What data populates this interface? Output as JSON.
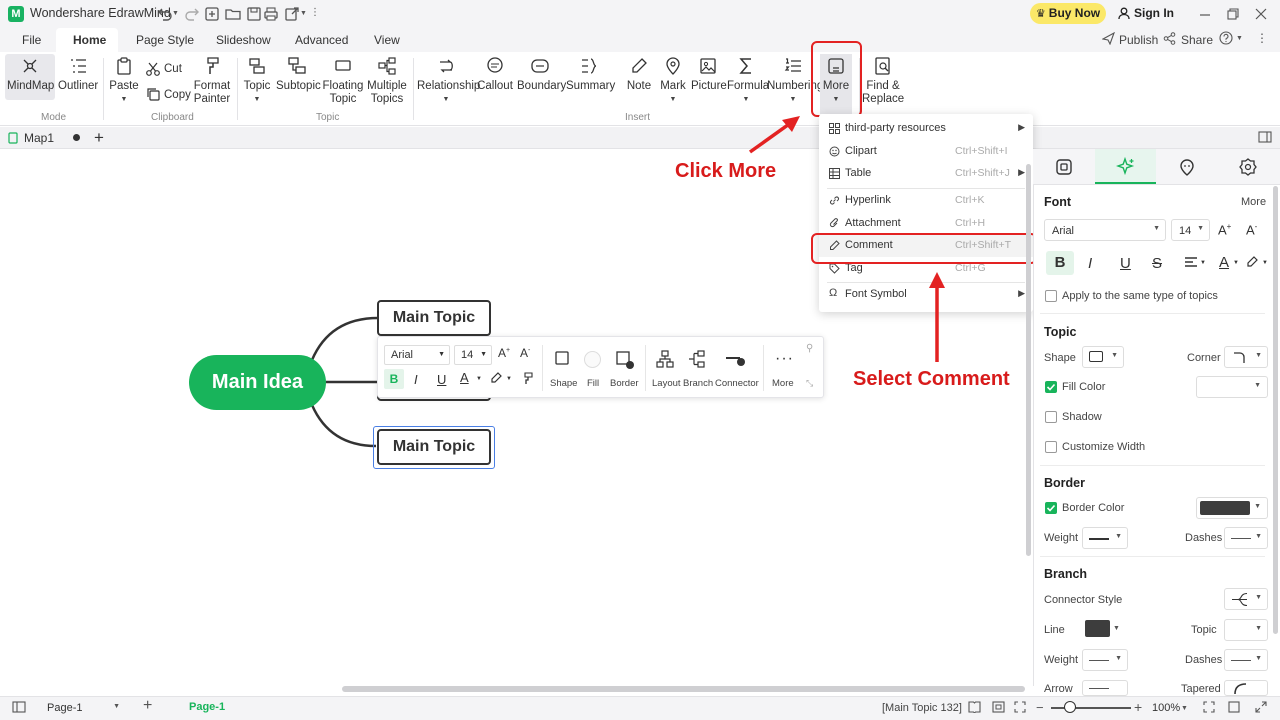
{
  "titlebar": {
    "app_title": "Wondershare EdrawMind",
    "buy_now": "Buy Now",
    "sign_in": "Sign In"
  },
  "menu": {
    "tabs": [
      "File",
      "Home",
      "Page Style",
      "Slideshow",
      "Advanced",
      "View"
    ],
    "publish": "Publish",
    "share": "Share"
  },
  "ribbon": {
    "mindmap": "MindMap",
    "outliner": "Outliner",
    "mode_label": "Mode",
    "paste": "Paste",
    "cut": "Cut",
    "copy": "Copy",
    "format_painter_1": "Format",
    "format_painter_2": "Painter",
    "clipboard_label": "Clipboard",
    "topic": "Topic",
    "subtopic": "Subtopic",
    "floating_1": "Floating",
    "floating_2": "Topic",
    "multiple_1": "Multiple",
    "multiple_2": "Topics",
    "topic_label": "Topic",
    "relationship": "Relationship",
    "callout": "Callout",
    "boundary": "Boundary",
    "summary": "Summary",
    "note": "Note",
    "mark": "Mark",
    "picture": "Picture",
    "formula": "Formula",
    "numbering": "Numbering",
    "more": "More",
    "insert_label": "Insert",
    "find_1": "Find &",
    "find_2": "Replace"
  },
  "doc_tab": {
    "name": "Map1"
  },
  "canvas": {
    "main_idea": "Main Idea",
    "topic_1": "Main Topic",
    "topic_2": "Main Topic"
  },
  "float_toolbar": {
    "font": "Arial",
    "size": "14",
    "bold": "B",
    "italic": "I",
    "underline": "U",
    "text_color": "A",
    "shape": "Shape",
    "fill": "Fill",
    "border": "Border",
    "layout": "Layout",
    "branch": "Branch",
    "connector": "Connector",
    "more": "More"
  },
  "dropdown": {
    "items": [
      {
        "label": "third-party resources",
        "shortcut": ""
      },
      {
        "label": "Clipart",
        "shortcut": "Ctrl+Shift+I"
      },
      {
        "label": "Table",
        "shortcut": "Ctrl+Shift+J"
      },
      {
        "label": "Hyperlink",
        "shortcut": "Ctrl+K"
      },
      {
        "label": "Attachment",
        "shortcut": "Ctrl+H"
      },
      {
        "label": "Comment",
        "shortcut": "Ctrl+Shift+T"
      },
      {
        "label": "Tag",
        "shortcut": "Ctrl+G"
      },
      {
        "label": "Font Symbol",
        "shortcut": ""
      }
    ]
  },
  "annotations": {
    "click_more": "Click More",
    "select_comment": "Select Comment",
    "color": "#d81b1b"
  },
  "right_panel": {
    "font_head": "Font",
    "more": "More",
    "font_name": "Arial",
    "font_size": "14",
    "bold": "B",
    "italic": "I",
    "underline": "U",
    "apply_same": "Apply to the same type of topics",
    "topic_head": "Topic",
    "shape": "Shape",
    "corner": "Corner",
    "fill_color": "Fill Color",
    "shadow": "Shadow",
    "customize_width": "Customize Width",
    "border_head": "Border",
    "border_color": "Border Color",
    "weight": "Weight",
    "dashes": "Dashes",
    "branch_head": "Branch",
    "connector_style": "Connector Style",
    "line": "Line",
    "topic": "Topic",
    "weight2": "Weight",
    "dashes2": "Dashes",
    "arrow": "Arrow",
    "tapered": "Tapered"
  },
  "statusbar": {
    "page_select": "Page-1",
    "page_tab": "Page-1",
    "selection": "[Main Topic 132]",
    "zoom": "100%"
  },
  "colors": {
    "brand_green": "#18b45b",
    "highlight_red": "#e32222",
    "selection_blue": "#4a7fe4"
  }
}
